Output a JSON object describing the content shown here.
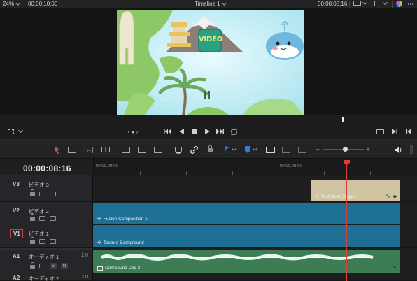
{
  "topbar": {
    "zoom": "24%",
    "duration": "00:00:10:00",
    "timeline_title": "Timeline 1",
    "current_time": "00:00:08:16"
  },
  "viewer": {
    "video_badge": "VIDEO"
  },
  "timeline": {
    "timecode": "00:00:08:16",
    "ruler_labels": [
      "00:00:00:00",
      "00:00:06:00"
    ]
  },
  "tracks": [
    {
      "id": "V3",
      "name": "ビデオ 3",
      "number": ""
    },
    {
      "id": "V2",
      "name": "ビデオ 2",
      "number": ""
    },
    {
      "id": "V1",
      "name": "ビデオ 1",
      "number": ""
    },
    {
      "id": "A1",
      "name": "オーディオ 1",
      "number": "2.0"
    },
    {
      "id": "A2",
      "name": "オーディオ 2",
      "number": "2.0"
    }
  ],
  "audio_buttons": {
    "solo": "S",
    "mute": "M"
  },
  "clips": {
    "text_over_shape": "Text Over Shape",
    "fusion_composition": "Fusion Composition 1",
    "texture_background": "Texture Background",
    "compound_clip": "Compound Clip 2"
  },
  "colors": {
    "video_clip": "#1d6f93",
    "text_clip": "#cfc3a2",
    "audio_clip": "#3d7d55",
    "playhead": "#e23b3b",
    "accent_blue": "#2f7bd8"
  },
  "icons": [
    "chevron-down-icon",
    "monitor-icon",
    "settings-icon",
    "go-start-icon",
    "step-back-icon",
    "stop-icon",
    "play-icon",
    "go-end-icon",
    "loop-icon",
    "pointer-icon",
    "trim-icon",
    "blade-icon",
    "snap-icon",
    "link-icon",
    "lock-icon",
    "flag-icon",
    "marker-icon",
    "zoom-icon",
    "volume-icon"
  ]
}
